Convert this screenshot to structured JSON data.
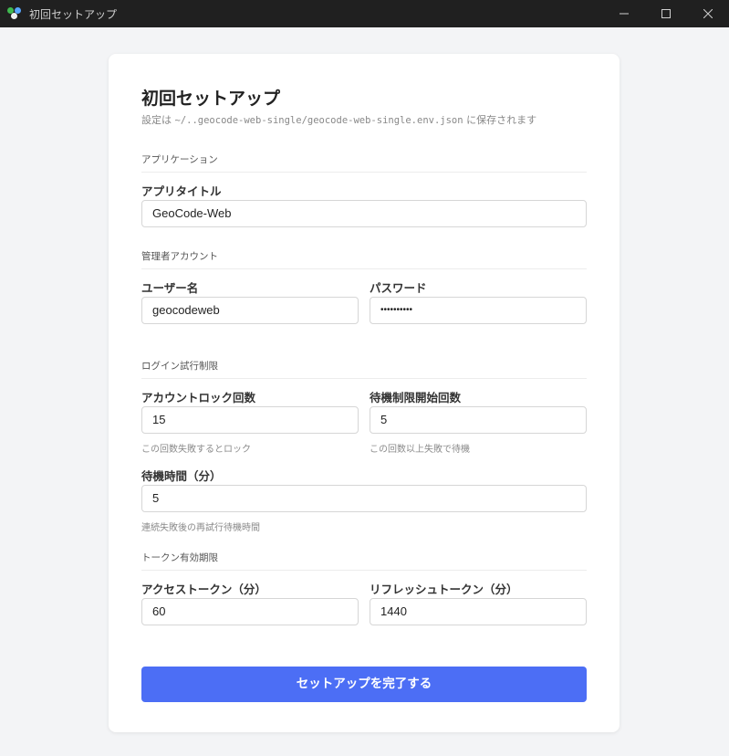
{
  "window": {
    "title": "初回セットアップ"
  },
  "header": {
    "title": "初回セットアップ",
    "subtitle_prefix": "設定は ",
    "subtitle_path": "~/..geocode-web-single/geocode-web-single.env.json",
    "subtitle_suffix": " に保存されます"
  },
  "sections": {
    "app": "アプリケーション",
    "admin": "管理者アカウント",
    "login": "ログイン試行制限",
    "token": "トークン有効期限"
  },
  "fields": {
    "app_title": {
      "label": "アプリタイトル",
      "value": "GeoCode-Web"
    },
    "username": {
      "label": "ユーザー名",
      "value": "geocodeweb"
    },
    "password": {
      "label": "パスワード",
      "value": "••••••••••"
    },
    "lock_count": {
      "label": "アカウントロック回数",
      "value": "15",
      "hint": "この回数失敗するとロック"
    },
    "wait_start": {
      "label": "待機制限開始回数",
      "value": "5",
      "hint": "この回数以上失敗で待機"
    },
    "wait_time": {
      "label": "待機時間（分）",
      "value": "5",
      "hint": "連続失敗後の再試行待機時間"
    },
    "access_token": {
      "label": "アクセストークン（分）",
      "value": "60"
    },
    "refresh_token": {
      "label": "リフレッシュトークン（分）",
      "value": "1440"
    }
  },
  "submit_label": "セットアップを完了する",
  "colors": {
    "accent": "#4c6ef5",
    "titlebar": "#202020"
  }
}
